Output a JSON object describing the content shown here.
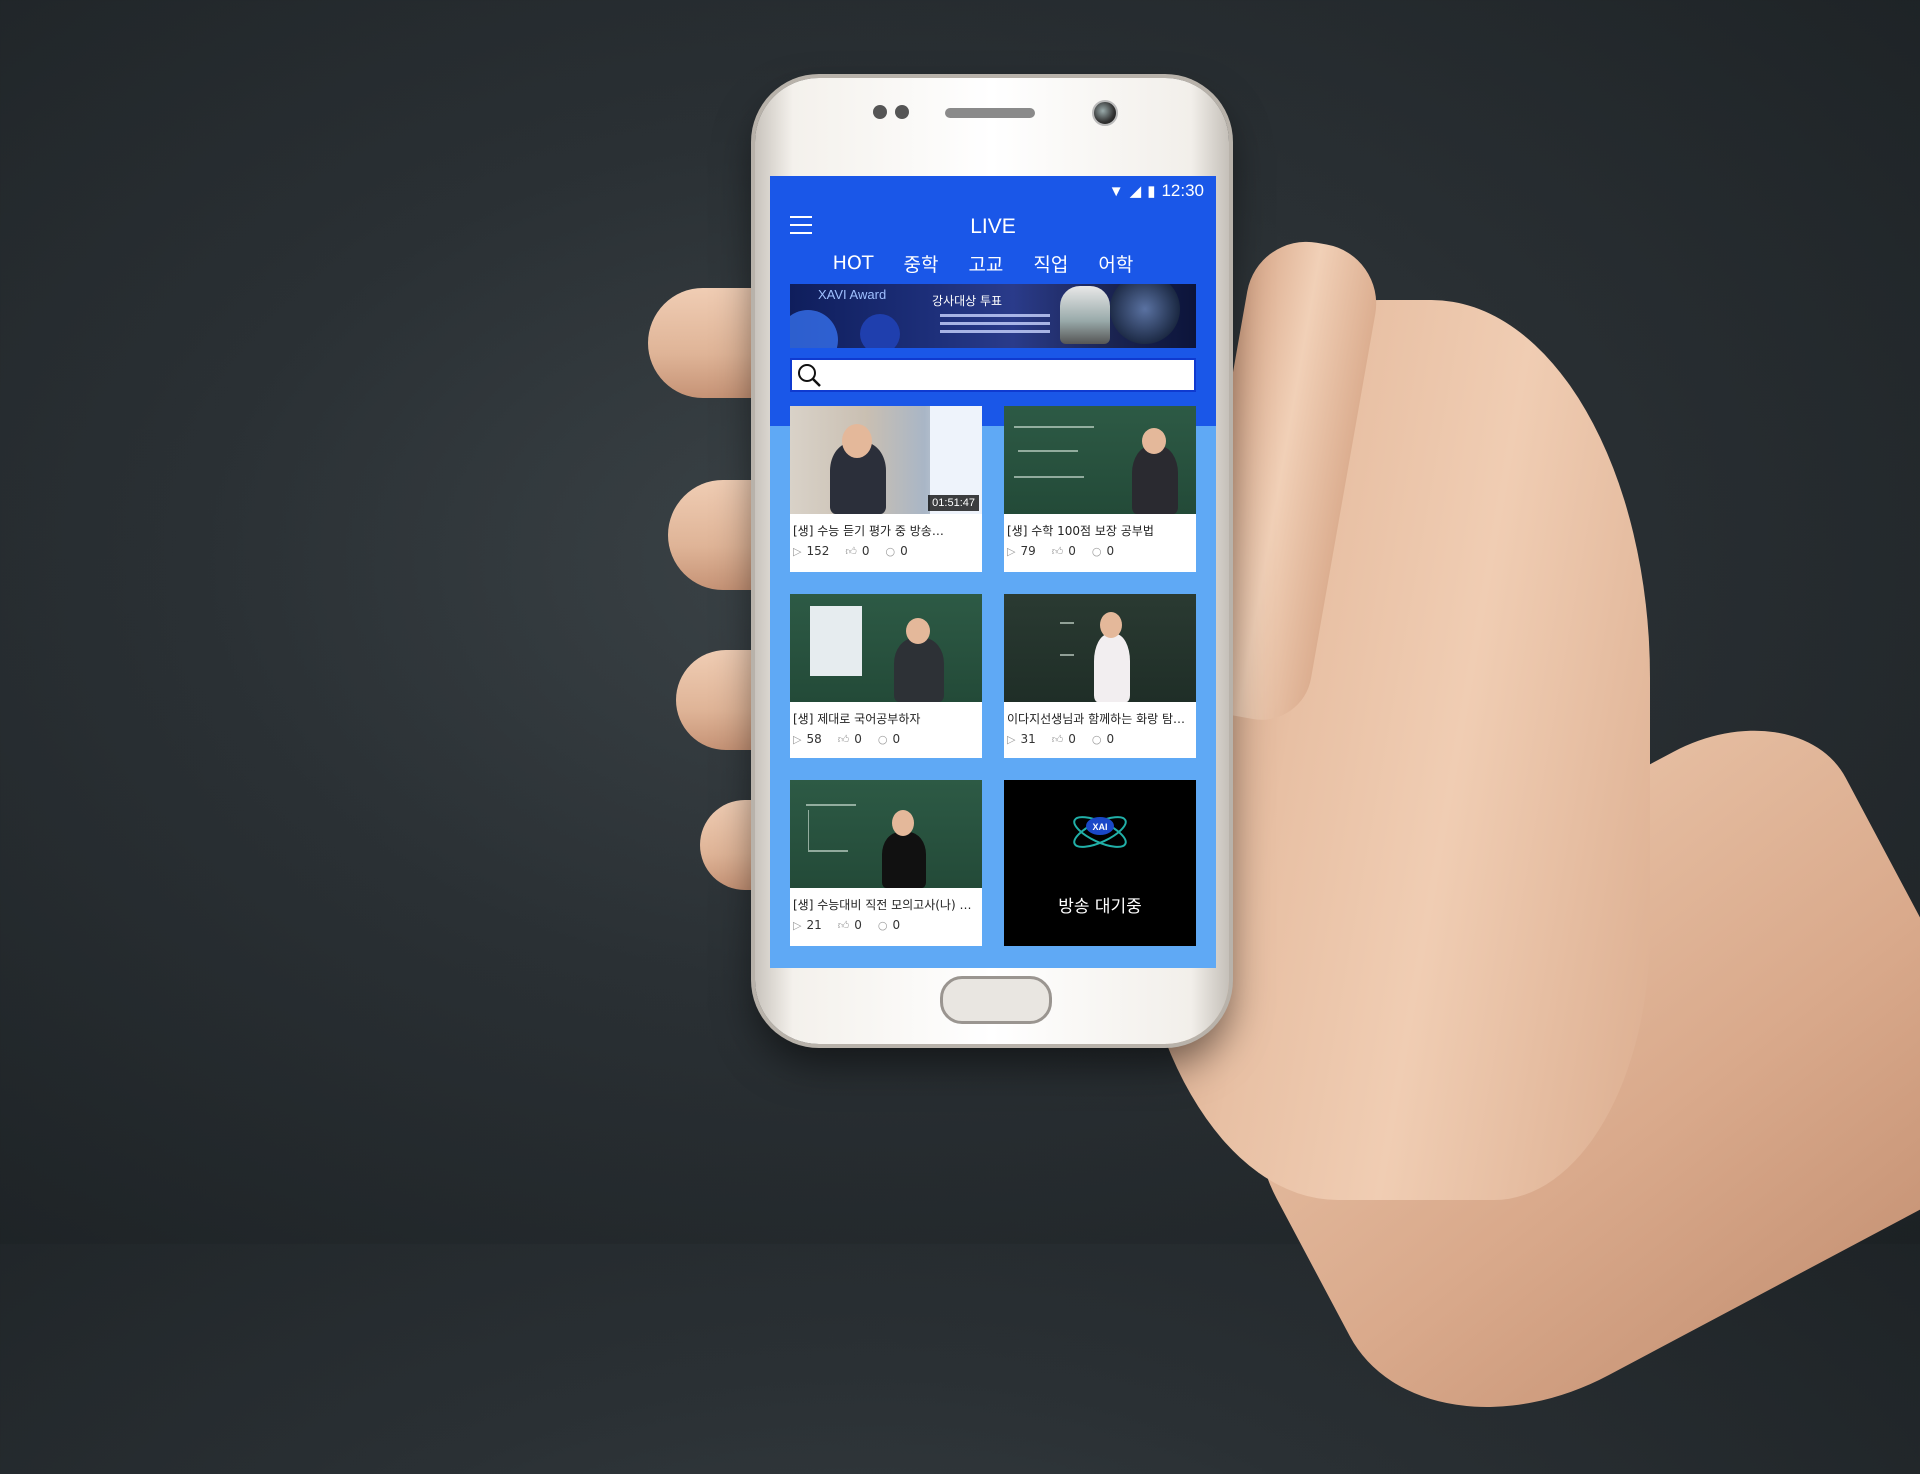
{
  "statusbar": {
    "time": "12:30"
  },
  "header": {
    "title": "LIVE"
  },
  "tabs": [
    {
      "label": "HOT"
    },
    {
      "label": "중학"
    },
    {
      "label": "고교"
    },
    {
      "label": "직업"
    },
    {
      "label": "어학"
    }
  ],
  "banner": {
    "label": "XAVI Award",
    "heading": "강사대상 투표"
  },
  "search": {
    "placeholder": ""
  },
  "cards": [
    {
      "title": "[생] 수능 듣기 평가 중 방송…",
      "duration": "01:51:47",
      "views": "152",
      "likes": "0",
      "comments": "0"
    },
    {
      "title": "[생] 수학 100점 보장 공부법",
      "views": "79",
      "likes": "0",
      "comments": "0"
    },
    {
      "title": "[생]  제대로 국어공부하자",
      "views": "58",
      "likes": "0",
      "comments": "0"
    },
    {
      "title": "이다지선생님과 함께하는 화랑 탐구영역",
      "views": "31",
      "likes": "0",
      "comments": "0"
    },
    {
      "title": "[생] 수능대비 직전 모의고사(나) 주요문항",
      "views": "21",
      "likes": "0",
      "comments": "0"
    }
  ],
  "standby": {
    "logo": "XAI",
    "text": "방송 대기중"
  },
  "colors": {
    "primary": "#1a57e8",
    "content_bg": "#5fa9f5"
  }
}
